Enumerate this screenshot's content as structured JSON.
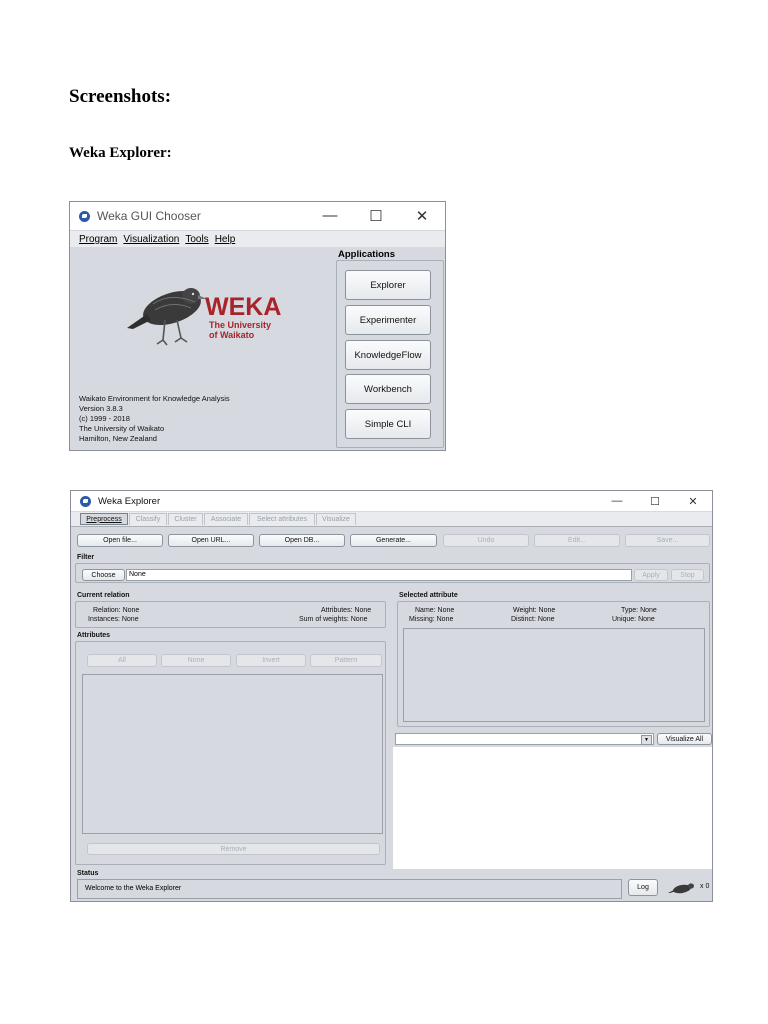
{
  "doc": {
    "heading": "Screenshots:",
    "subheading": "Weka Explorer:"
  },
  "colors": {
    "weka_red": "#a8242a",
    "window_bg": "#d6d9df",
    "accent": "#2b5aa8"
  },
  "chooser": {
    "title": "Weka GUI Chooser",
    "window_controls": {
      "minimize": "—",
      "maximize": "☐",
      "close": "✕"
    },
    "menu": [
      {
        "label": "Program"
      },
      {
        "label": "Visualization"
      },
      {
        "label": "Tools"
      },
      {
        "label": "Help"
      }
    ],
    "applications_label": "Applications",
    "apps": [
      {
        "label": "Explorer"
      },
      {
        "label": "Experimenter"
      },
      {
        "label": "KnowledgeFlow"
      },
      {
        "label": "Workbench"
      },
      {
        "label": "Simple CLI"
      }
    ],
    "logo": {
      "word": "WEKA",
      "sub1": "The University",
      "sub2": "of Waikato"
    },
    "info": [
      "Waikato Environment for Knowledge Analysis",
      "Version 3.8.3",
      "(c) 1999 - 2018",
      "The University of Waikato",
      "Hamilton, New Zealand"
    ]
  },
  "explorer": {
    "title": "Weka Explorer",
    "window_controls": {
      "minimize": "—",
      "maximize": "☐",
      "close": "✕"
    },
    "tabs": [
      {
        "label": "Preprocess"
      },
      {
        "label": "Classify"
      },
      {
        "label": "Cluster"
      },
      {
        "label": "Associate"
      },
      {
        "label": "Select attributes"
      },
      {
        "label": "Visualize"
      }
    ],
    "toolbar": {
      "open_file": "Open file...",
      "open_url": "Open URL...",
      "open_db": "Open DB...",
      "generate": "Generate...",
      "undo": "Undo",
      "edit": "Edit...",
      "save": "Save..."
    },
    "filter": {
      "label": "Filter",
      "choose": "Choose",
      "value": "None",
      "apply": "Apply",
      "stop": "Stop"
    },
    "current_relation": {
      "label": "Current relation",
      "relation": "Relation: None",
      "instances": "Instances: None",
      "attributes": "Attributes: None",
      "sum_weights": "Sum of weights: None"
    },
    "attributes": {
      "label": "Attributes",
      "all": "All",
      "none": "None",
      "invert": "Invert",
      "pattern": "Pattern",
      "remove": "Remove"
    },
    "selected_attribute": {
      "label": "Selected attribute",
      "name": "Name: None",
      "missing": "Missing: None",
      "weight": "Weight: None",
      "distinct": "Distinct: None",
      "type": "Type: None",
      "unique": "Unique: None"
    },
    "visualize_all": "Visualize All",
    "dropdown_arrow": "▼",
    "status": {
      "label": "Status",
      "message": "Welcome to the Weka Explorer",
      "log": "Log",
      "count": "x 0"
    }
  }
}
